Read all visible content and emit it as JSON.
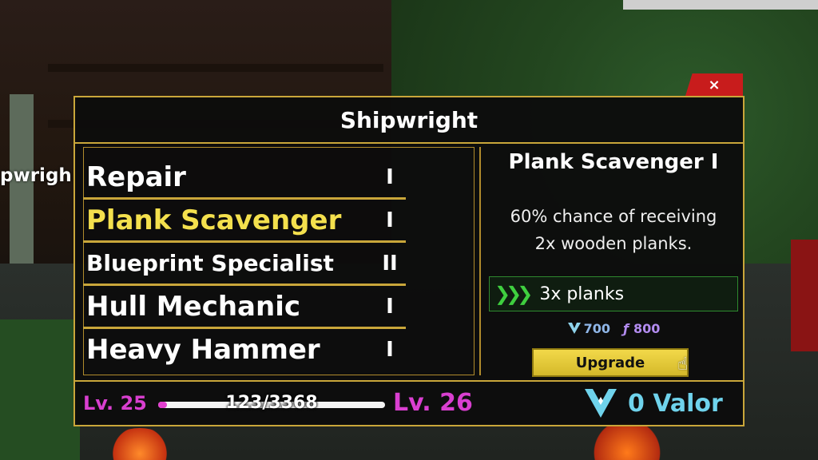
{
  "background": {
    "side_label": "pwrigh"
  },
  "window": {
    "title": "Shipwright",
    "close_label": "×"
  },
  "skills": [
    {
      "name": "Repair",
      "level": "I"
    },
    {
      "name": "Plank Scavenger",
      "level": "I"
    },
    {
      "name": "Blueprint Specialist",
      "level": "II"
    },
    {
      "name": "Hull Mechanic",
      "level": "I"
    },
    {
      "name": "Heavy Hammer",
      "level": "I"
    }
  ],
  "selected_skill_index": 1,
  "detail": {
    "title": "Plank Scavenger I",
    "description_line1": "60% chance of receiving",
    "description_line2": "2x wooden planks.",
    "benefit": "3x planks",
    "cost_valor": "700",
    "cost_fragment_symbol": "ƒ",
    "cost_fragments": "800",
    "upgrade_label": "Upgrade"
  },
  "progress": {
    "current_level": "Lv. 25",
    "next_level": "Lv. 26",
    "xp_text": "123/3368",
    "xp_fraction": 0.037
  },
  "valor": {
    "text": "0 Valor"
  },
  "colors": {
    "accent_gold": "#c9a63a",
    "selected_text": "#f4e04d",
    "level_magenta": "#d93fd0",
    "valor_cyan": "#6fd3ec",
    "close_red": "#c81c1c",
    "upgrade_yellow": "#e6cc38",
    "benefit_green": "#3fcf3f"
  },
  "icons": [
    "close-icon",
    "chevron-arrows-icon",
    "valor-v-icon",
    "fragment-f-icon",
    "pointer-cursor-icon"
  ]
}
